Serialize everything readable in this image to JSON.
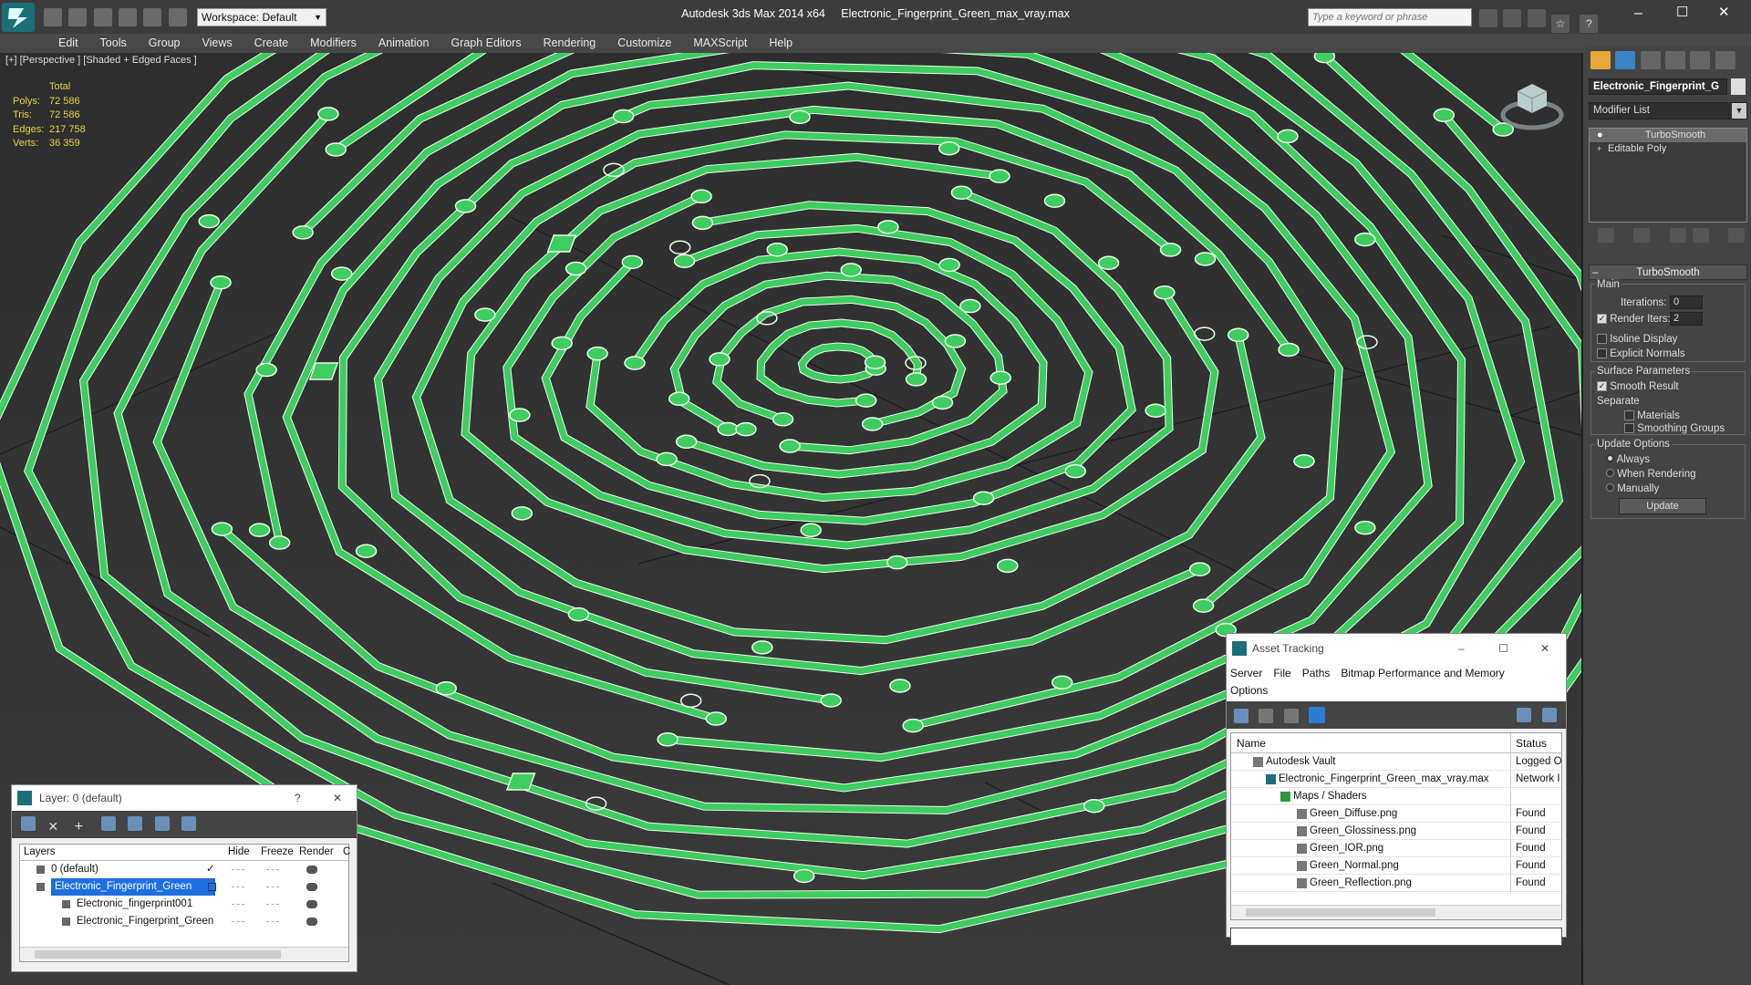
{
  "app": {
    "title": "Autodesk 3ds Max  2014 x64",
    "file": "Electronic_Fingerprint_Green_max_vray.max",
    "workspace": "Workspace: Default",
    "search_placeholder": "Type a keyword or phrase"
  },
  "menu": [
    "Edit",
    "Tools",
    "Group",
    "Views",
    "Create",
    "Modifiers",
    "Animation",
    "Graph Editors",
    "Rendering",
    "Customize",
    "MAXScript",
    "Help"
  ],
  "viewport": {
    "label": "[+] [Perspective ] [Shaded + Edged Faces ]",
    "stats": {
      "header": "Total",
      "rows": [
        {
          "k": "Polys:",
          "v": "72 586"
        },
        {
          "k": "Tris:",
          "v": "72 586"
        },
        {
          "k": "Edges:",
          "v": "217 758"
        },
        {
          "k": "Verts:",
          "v": "36 359"
        }
      ]
    }
  },
  "panel": {
    "object_name": "Electronic_Fingerprint_G",
    "modifier_list": "Modifier List",
    "stack": [
      "TurboSmooth",
      "Editable Poly"
    ],
    "rollout": {
      "title": "TurboSmooth",
      "main": "Main",
      "iterations_label": "Iterations:",
      "iterations": "0",
      "render_iters_label": "Render Iters:",
      "render_iters": "2",
      "isoline": "Isoline Display",
      "explicit": "Explicit Normals",
      "surface": "Surface Parameters",
      "smooth_result": "Smooth Result",
      "separate": "Separate",
      "materials": "Materials",
      "smoothing_groups": "Smoothing Groups",
      "update_options": "Update Options",
      "always": "Always",
      "when_rendering": "When Rendering",
      "manually": "Manually",
      "update_btn": "Update"
    }
  },
  "layer_window": {
    "title": "Layer: 0 (default)",
    "help": "?",
    "columns": [
      "Layers",
      "Hide",
      "Freeze",
      "Render",
      "C"
    ],
    "rows": [
      "0 (default)",
      "Electronic_Fingerprint_Green",
      "Electronic_fingerprint001",
      "Electronic_Fingerprint_Green"
    ]
  },
  "asset_window": {
    "title": "Asset Tracking",
    "menu": [
      "Server",
      "File",
      "Paths",
      "Bitmap Performance and Memory",
      "Options"
    ],
    "columns": [
      "Name",
      "Status"
    ],
    "rows": [
      {
        "name": "Autodesk Vault",
        "status": "Logged O"
      },
      {
        "name": "Electronic_Fingerprint_Green_max_vray.max",
        "status": "Network I"
      },
      {
        "name": "Maps / Shaders",
        "status": ""
      },
      {
        "name": "Green_Diffuse.png",
        "status": "Found"
      },
      {
        "name": "Green_Glossiness.png",
        "status": "Found"
      },
      {
        "name": "Green_IOR.png",
        "status": "Found"
      },
      {
        "name": "Green_Normal.png",
        "status": "Found"
      },
      {
        "name": "Green_Reflection.png",
        "status": "Found"
      }
    ]
  },
  "colors": {
    "trace": "#3fcc61",
    "stats": "#e8d34a",
    "selection": "#1e6fe0"
  }
}
